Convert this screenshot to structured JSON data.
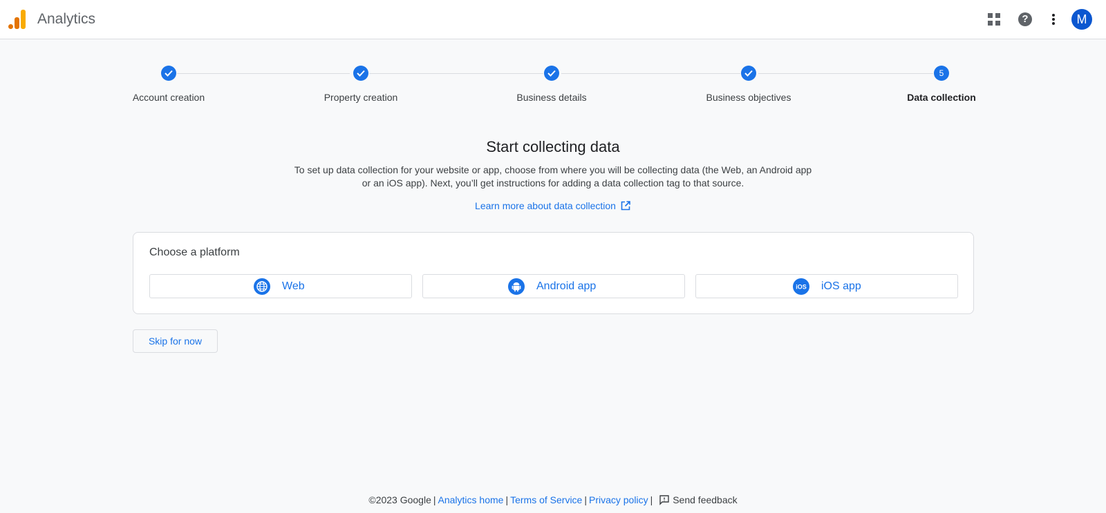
{
  "header": {
    "app_title": "Analytics",
    "avatar_initial": "M",
    "icons": [
      "analytics-logo",
      "apps-grid-icon",
      "help-icon",
      "more-vert-icon"
    ]
  },
  "stepper": {
    "steps": [
      {
        "label": "Account creation",
        "state": "done"
      },
      {
        "label": "Property creation",
        "state": "done"
      },
      {
        "label": "Business details",
        "state": "done"
      },
      {
        "label": "Business objectives",
        "state": "done"
      },
      {
        "label": "Data collection",
        "state": "active",
        "number": "5"
      }
    ]
  },
  "main": {
    "title": "Start collecting data",
    "description": "To set up data collection for your website or app, choose from where you will be collecting data (the Web, an Android app or an iOS app). Next, you’ll get instructions for adding a data collection tag to that source.",
    "learn_more": "Learn more about data collection",
    "card_title": "Choose a platform",
    "platforms": [
      {
        "label": "Web",
        "icon": "globe-icon"
      },
      {
        "label": "Android app",
        "icon": "android-icon"
      },
      {
        "label": "iOS app",
        "icon": "ios-icon"
      }
    ],
    "skip_label": "Skip for now"
  },
  "footer": {
    "copyright": "©2023 Google",
    "links": [
      "Analytics home",
      "Terms of Service",
      "Privacy policy"
    ],
    "feedback": "Send feedback"
  },
  "colors": {
    "accent": "#1a73e8",
    "background": "#f8f9fa",
    "logo_orange": "#e37400",
    "logo_yellow": "#f9ab00",
    "avatar": "#0b57d0"
  }
}
